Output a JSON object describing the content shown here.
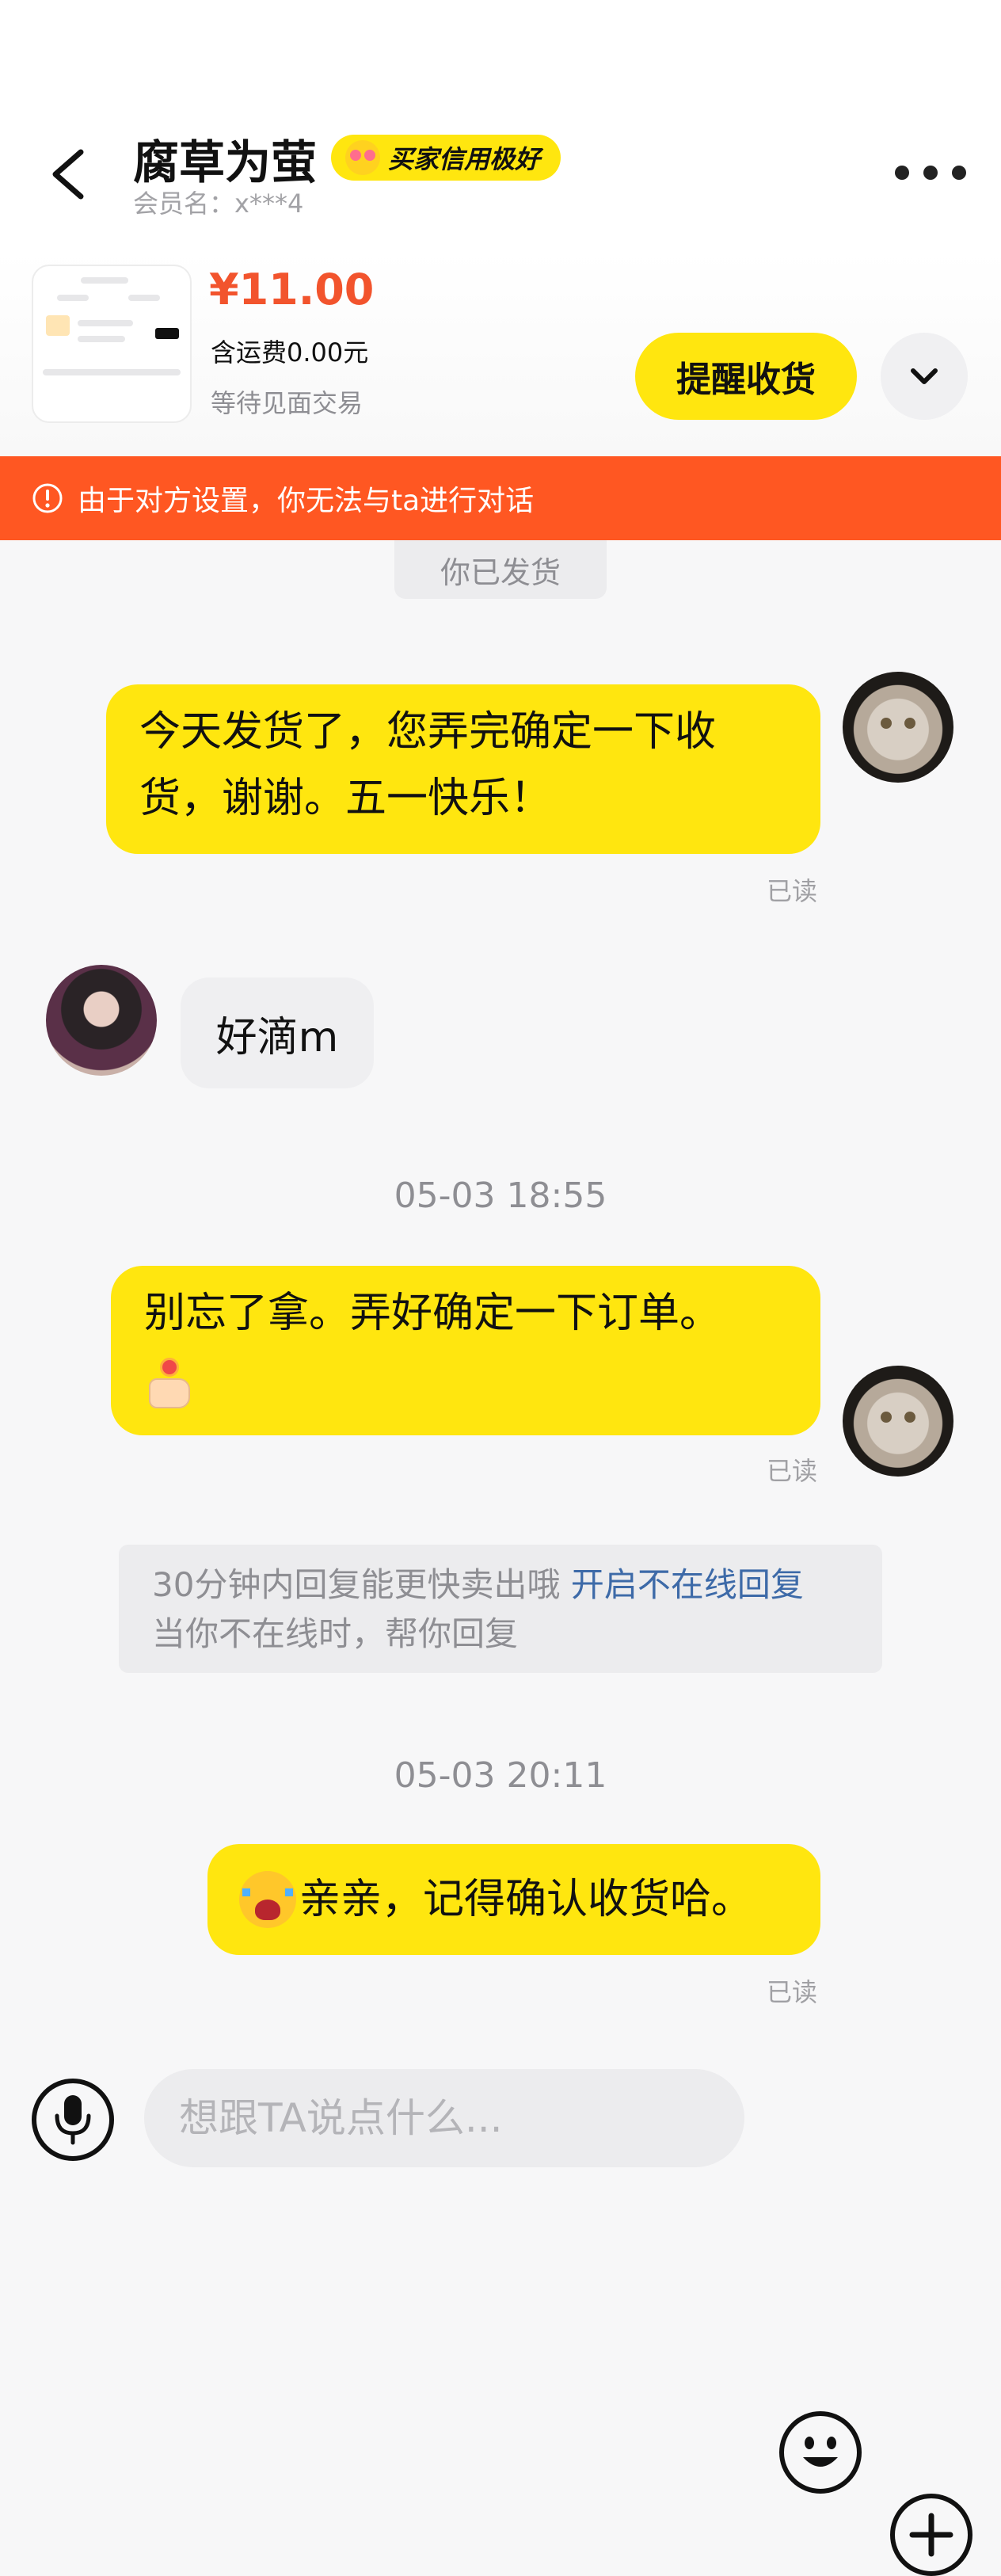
{
  "header": {
    "title": "腐草为萤",
    "credit_badge": "买家信用极好",
    "member_name": "会员名：x***4"
  },
  "product": {
    "price": "¥11.00",
    "shipping": "含运费0.00元",
    "status": "等待见面交易",
    "remind_button": "提醒收货"
  },
  "notice": {
    "text": "由于对方设置，你无法与ta进行对话"
  },
  "chat": {
    "system_status": "你已发货",
    "messages": [
      {
        "from": "me",
        "text": "今天发货了，您弄完确定一下收货，谢谢。五一快乐！",
        "status": "已读"
      },
      {
        "from": "other",
        "text": "好滴m"
      },
      {
        "timestamp": "05-03 18:55"
      },
      {
        "from": "me",
        "text": "别忘了拿。弄好确定一下订单。",
        "emoji": "flower-thumb-emoji",
        "status": "已读"
      },
      {
        "tip": {
          "text": "30分钟内回复能更快卖出哦",
          "link": "开启不在线回复",
          "sub": "当你不在线时，帮你回复"
        }
      },
      {
        "timestamp": "05-03 20:11"
      },
      {
        "from": "me",
        "emoji": "crying-emoji",
        "text": "亲亲，记得确认收货哈。",
        "status": "已读"
      }
    ]
  },
  "input": {
    "placeholder": "想跟TA说点什么..."
  },
  "colors": {
    "accent_yellow": "#ffe60f",
    "price_red": "#f2542d",
    "notice_orange": "#ff5722",
    "link_blue": "#3d6aa8"
  }
}
